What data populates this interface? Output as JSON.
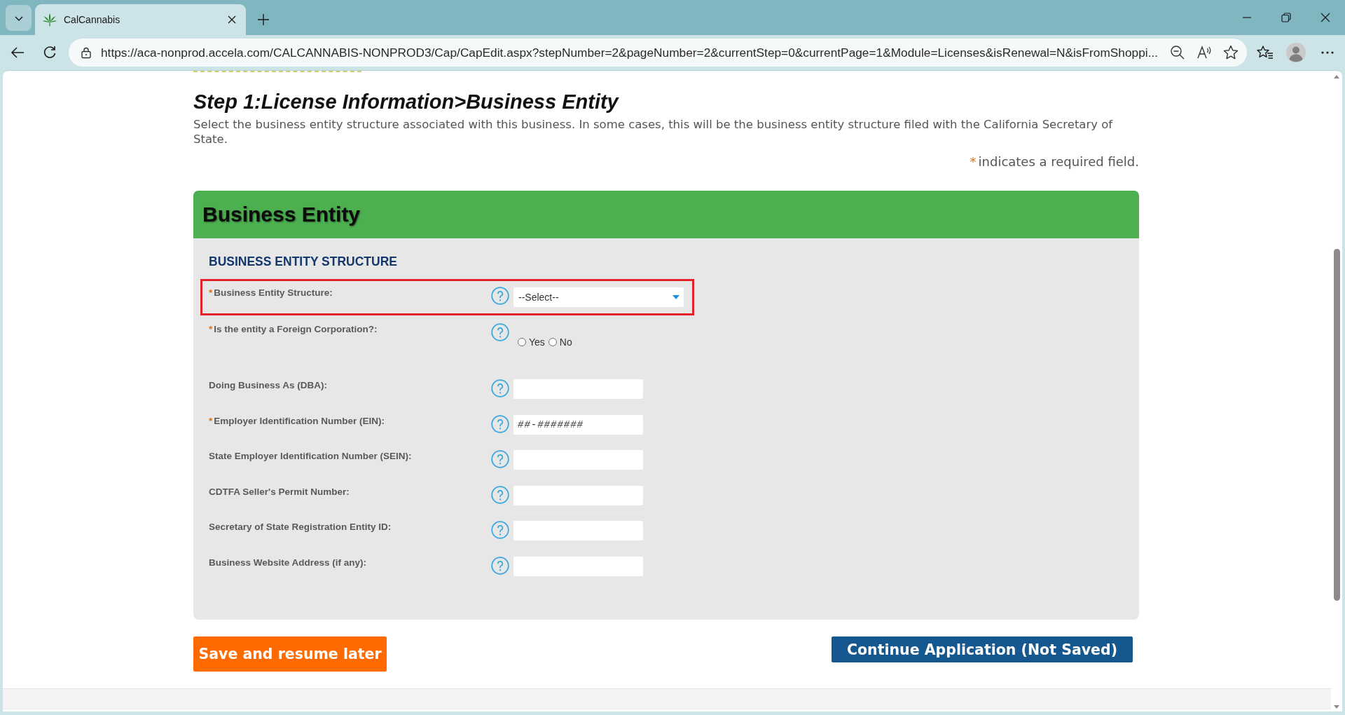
{
  "browser": {
    "tabs": [
      {
        "title": "CalCannabis",
        "selected": true
      }
    ],
    "address": "https://aca-nonprod.accela.com/CALCANNABIS-NONPROD3/Cap/CapEdit.aspx?stepNumber=2&pageNumber=2&currentStep=0&currentPage=1&Module=Licenses&isRenewal=N&isFromShoppi..."
  },
  "page": {
    "heading": "Step 1:License Information>Business Entity",
    "description": "Select the business entity structure associated with this business. In some cases, this will be the business entity structure filed with the California Secretary of State.",
    "required_note": {
      "mark": "*",
      "text": "indicates a required field."
    },
    "section": {
      "title": "Business Entity",
      "subtitle": "BUSINESS ENTITY STRUCTURE",
      "required_mark": "*",
      "fields": [
        {
          "kind": "select",
          "label": "Business Entity Structure:",
          "required": true,
          "highlighted": true,
          "value": "--Select--"
        },
        {
          "kind": "radio",
          "label": "Is the entity a Foreign Corporation?:",
          "required": true,
          "highlighted": false,
          "options": [
            {
              "label": "Yes",
              "selected": false
            },
            {
              "label": "No",
              "selected": false
            }
          ]
        },
        {
          "kind": "text",
          "label": "Doing Business As (DBA):",
          "required": false,
          "highlighted": false
        },
        {
          "kind": "text",
          "label": "Employer Identification Number (EIN):",
          "required": true,
          "highlighted": false,
          "placeholder": "##-#######"
        },
        {
          "kind": "text",
          "label": "State Employer Identification Number (SEIN):",
          "required": false,
          "highlighted": false
        },
        {
          "kind": "text",
          "label": "CDTFA Seller's Permit Number:",
          "required": false,
          "highlighted": false
        },
        {
          "kind": "text",
          "label": "Secretary of State Registration Entity ID:",
          "required": false,
          "highlighted": false
        },
        {
          "kind": "text",
          "label": "Business Website Address (if any):",
          "required": false,
          "highlighted": false
        }
      ]
    },
    "buttons": [
      {
        "label": "Save and resume later",
        "kind": "secondary"
      },
      {
        "label": "Continue Application (Not Saved)",
        "kind": "primary"
      }
    ]
  }
}
